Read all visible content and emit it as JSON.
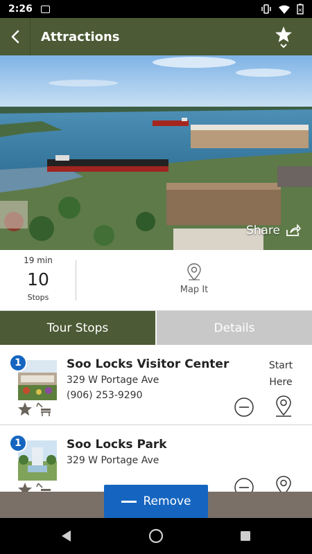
{
  "status_bar": {
    "time": "2:26"
  },
  "app_bar": {
    "title": "Attractions"
  },
  "hero": {
    "share_label": "Share"
  },
  "summary": {
    "duration": "19 min",
    "stop_count": "10",
    "stops_label": "Stops",
    "map_it_label": "Map It"
  },
  "tabs": [
    {
      "label": "Tour Stops",
      "active": true
    },
    {
      "label": "Details",
      "active": false
    }
  ],
  "stops": [
    {
      "number": "1",
      "name": "Soo Locks Visitor Center",
      "address": "329 W Portage Ave",
      "phone": "(906) 253-9290",
      "start_line1": "Start",
      "start_line2": "Here"
    },
    {
      "number": "1",
      "name": "Soo Locks Park",
      "address": "329 W Portage Ave"
    }
  ],
  "footer": {
    "remove_label": "Remove"
  },
  "colors": {
    "primary": "#4c5a35",
    "accent": "#1565c0",
    "tab_inactive": "#c8c8c8"
  },
  "icons": [
    "back-arrow-icon",
    "star-icon",
    "chevron-down-icon",
    "share-icon",
    "map-pin-icon",
    "favorite-star-icon",
    "bench-icon",
    "minus-circle-icon"
  ]
}
